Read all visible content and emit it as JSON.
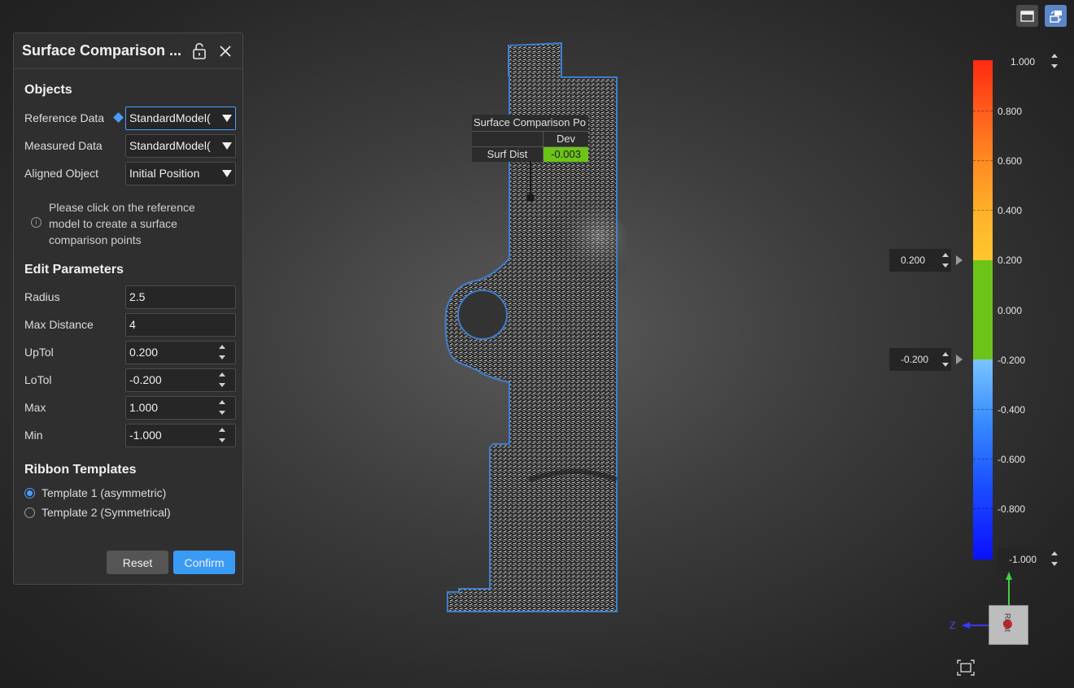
{
  "panel": {
    "title": "Surface Comparison ...",
    "icons": [
      "unlock-icon",
      "close-icon"
    ],
    "objects_title": "Objects",
    "reference_label": "Reference Data",
    "reference_value": "StandardModel(",
    "measured_label": "Measured Data",
    "measured_value": "StandardModel(",
    "aligned_label": "Aligned Object",
    "aligned_value": "Initial Position",
    "hint": "Please click on the reference model to create a surface comparison points",
    "info_glyph": "i",
    "edit_title": "Edit Parameters",
    "radius_label": "Radius",
    "radius_value": "2.5",
    "maxdist_label": "Max Distance",
    "maxdist_value": "4",
    "uptol_label": "UpTol",
    "uptol_value": "0.200",
    "lotol_label": "LoTol",
    "lotol_value": "-0.200",
    "max_label": "Max",
    "max_value": "1.000",
    "min_label": "Min",
    "min_value": "-1.000",
    "ribbon_title": "Ribbon Templates",
    "template1": "Template 1 (asymmetric)",
    "template2": "Template 2 (Symmetrical)",
    "selected_template": 1,
    "reset": "Reset",
    "confirm": "Confirm",
    "accent_color": "#3a9bf5"
  },
  "annotation": {
    "title": "Surface Comparison Po",
    "col_header": "Dev",
    "row_label": "Surf Dist",
    "row_value": "-0.003",
    "value_color": "#6cc418"
  },
  "colorbar": {
    "max_value": "1.000",
    "min_value": "-1.000",
    "upper_tol": "0.200",
    "lower_tol": "-0.200",
    "tick_labels": [
      "0.800",
      "0.600",
      "0.400",
      "0.200",
      "0.000",
      "-0.200",
      "-0.400",
      "-0.600",
      "-0.800"
    ],
    "in_tolerance_color": "#6cc418",
    "high_color": "#ff2a10",
    "low_color": "#0a10ff"
  },
  "axes": {
    "z_label": "Z",
    "cube_face": "Right"
  },
  "toolbar_icons": [
    "display-mode-icon",
    "swap-view-icon",
    "fit-view-icon"
  ]
}
